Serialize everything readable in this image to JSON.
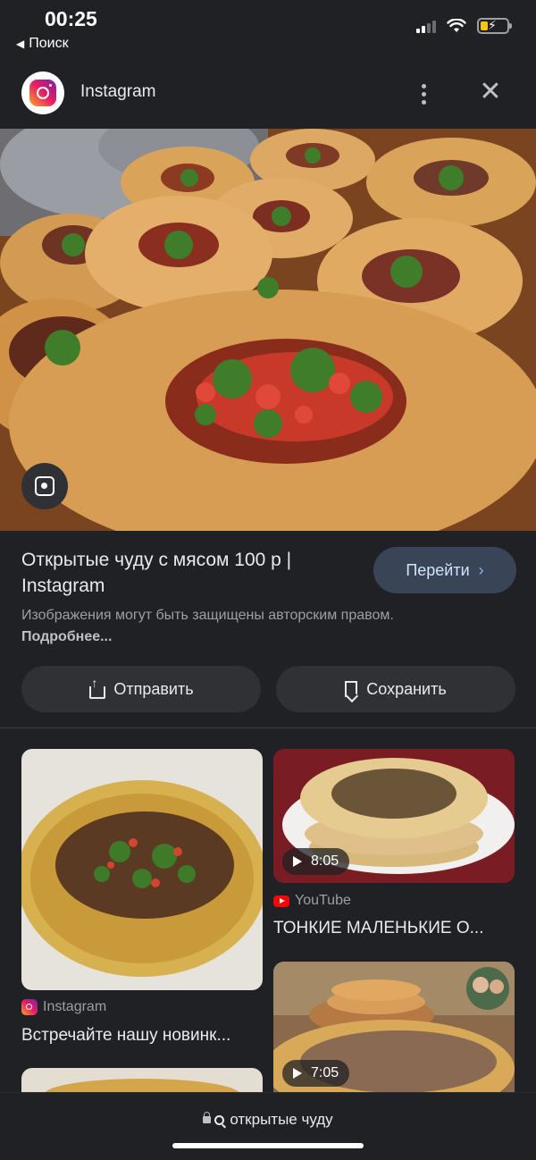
{
  "status_bar": {
    "time": "00:25",
    "back_label": "Поиск"
  },
  "header": {
    "source_name": "Instagram"
  },
  "result": {
    "title": "Открытые чуду с мясом 100 р | Instagram",
    "goto_label": "Перейти",
    "copyright_text": "Изображения могут быть защищены авторским правом.",
    "copyright_more": "Подробнее...",
    "share_label": "Отправить",
    "save_label": "Сохранить"
  },
  "related": [
    {
      "source": "Instagram",
      "source_icon": "instagram-icon",
      "title": "Встречайте нашу новинк..."
    },
    {
      "source": "YouTube",
      "source_icon": "youtube-icon",
      "title": "ТОНКИЕ МАЛЕНЬКИЕ О...",
      "duration": "8:05"
    },
    {
      "duration": "7:05"
    }
  ],
  "bottom_bar": {
    "query": "открытые чуду"
  },
  "colors": {
    "background": "#202124",
    "button": "#303134",
    "goto_button": "#394457",
    "accent": "#8ab4f8"
  }
}
